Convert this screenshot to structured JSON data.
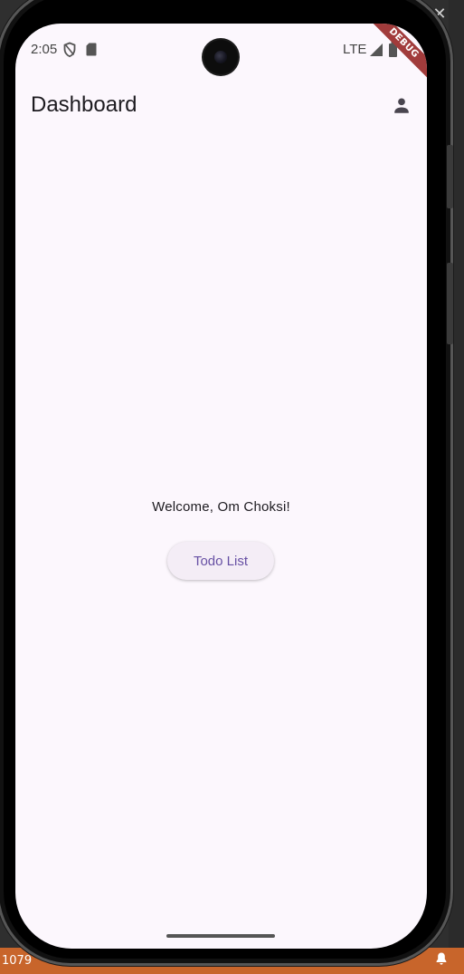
{
  "ide": {
    "close_glyph": "✕",
    "bottom_text": "1079"
  },
  "status_bar": {
    "time": "2:05",
    "network": "LTE"
  },
  "debug_banner": "DEBUG",
  "app_bar": {
    "title": "Dashboard",
    "profile_icon": "person-icon"
  },
  "body": {
    "welcome_text": "Welcome, Om Choksi!",
    "todo_button_label": "Todo List"
  },
  "colors": {
    "background": "#fcf7fd",
    "primary": "#6750a4",
    "button_bg": "#f4edf6",
    "debug_banner": "#a13b3b"
  }
}
